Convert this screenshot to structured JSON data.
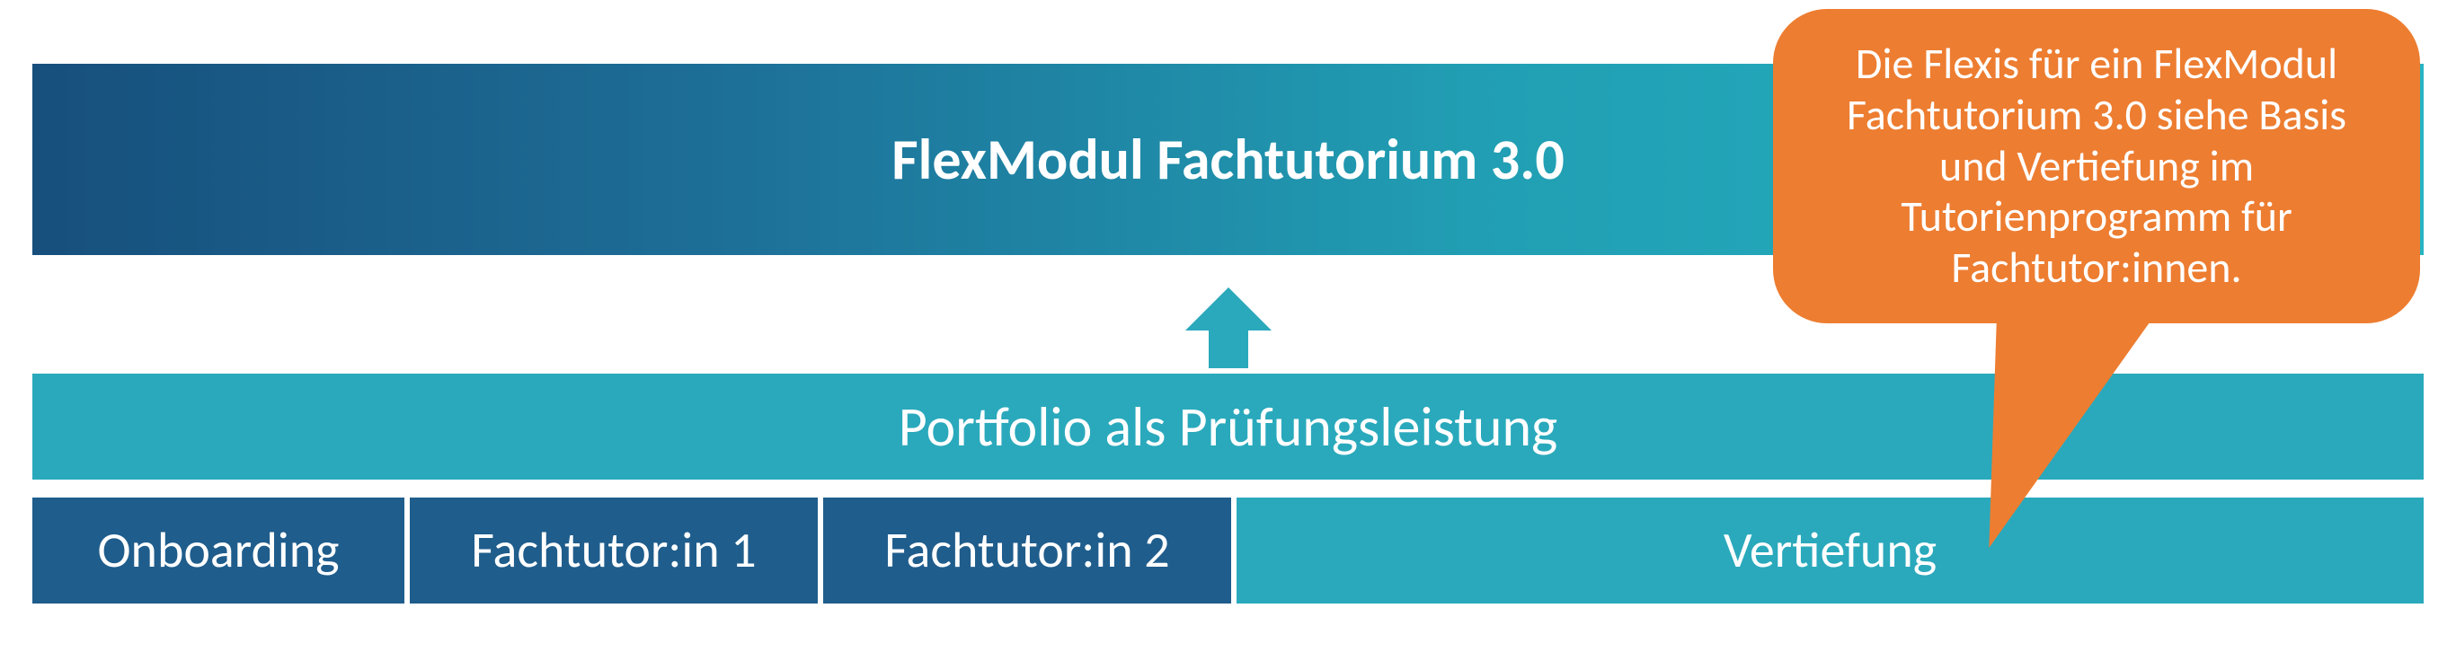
{
  "topBanner": {
    "title": "FlexModul Fachtutorium 3.0"
  },
  "portfolio": {
    "label": "Portfolio als Prüfungsleistung"
  },
  "bottomCells": {
    "onboarding": "Onboarding",
    "ft1": "Fachtutor:in 1",
    "ft2": "Fachtutor:in 2",
    "vertiefung": "Vertiefung"
  },
  "callout": {
    "text": "Die Flexis für ein FlexModul Fachtutorium 3.0  siehe Basis und Vertiefung im Tutorienprogramm für Fachtutor:innen."
  },
  "colors": {
    "bannerGradientStart": "#174f7c",
    "bannerGradientEnd": "#27b4c3",
    "teal": "#2aa9bc",
    "darkBlue": "#1f5d8c",
    "calloutOrange": "#ed7d31",
    "border": "#ffffff"
  }
}
